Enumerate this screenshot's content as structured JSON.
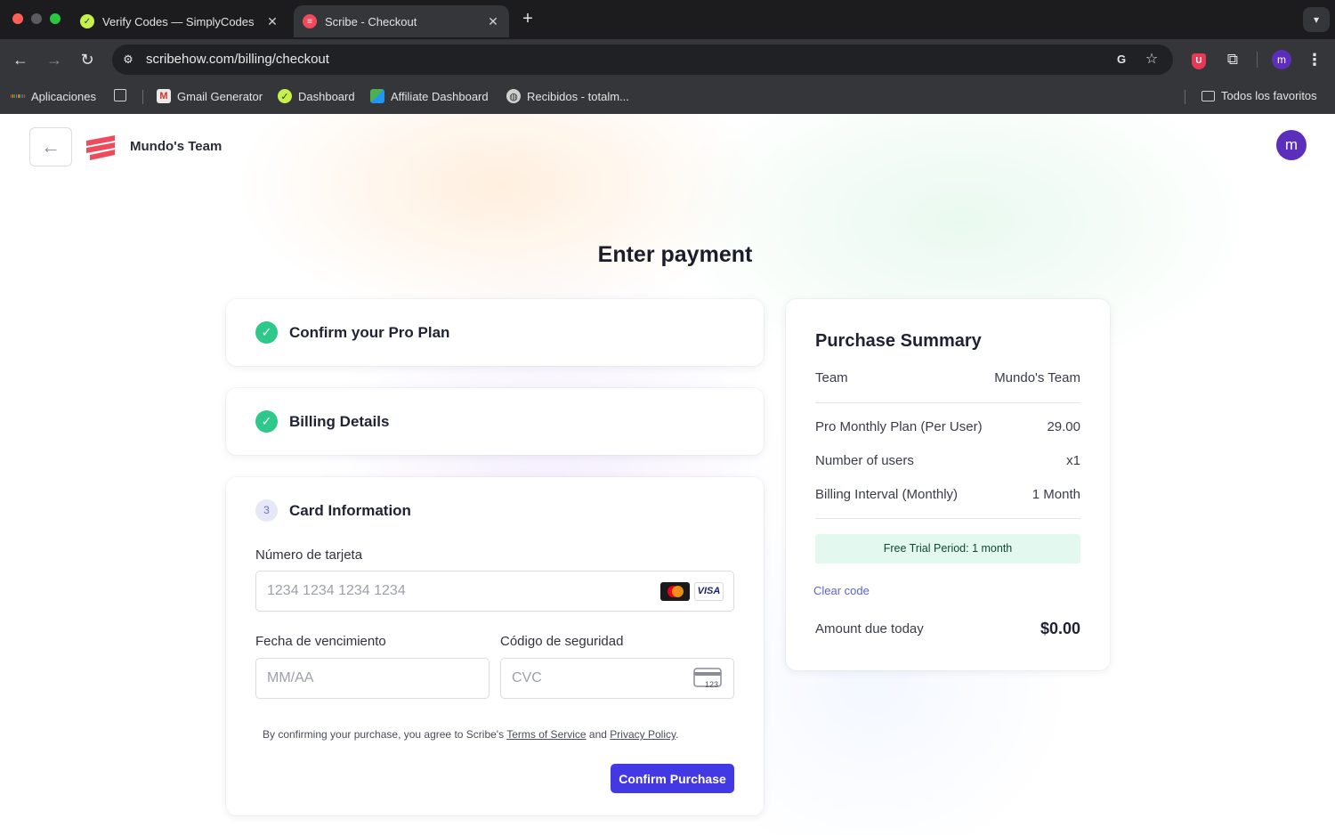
{
  "browser": {
    "tabs": [
      {
        "title": "Verify Codes — SimplyCodes",
        "favicon": "simplycodes-icon",
        "active": false
      },
      {
        "title": "Scribe - Checkout",
        "favicon": "scribe-icon",
        "active": true
      }
    ],
    "url": "scribehow.com/billing/checkout",
    "profile_initial": "m",
    "bookmarks": [
      {
        "label": "Aplicaciones",
        "icon": "apps-grid-icon"
      },
      {
        "label": "Gmail Generator",
        "icon": "gmail-generator-icon"
      },
      {
        "label": "Dashboard",
        "icon": "simplycodes-icon"
      },
      {
        "label": "Affiliate Dashboard",
        "icon": "affiliate-icon"
      },
      {
        "label": "Recibidos - totalm...",
        "icon": "globe-icon"
      }
    ],
    "all_bookmarks_label": "Todos los favoritos"
  },
  "header": {
    "team_name": "Mundo's Team",
    "avatar_initial": "m"
  },
  "page_title": "Enter payment",
  "steps": [
    {
      "title": "Confirm your Pro Plan",
      "status": "complete"
    },
    {
      "title": "Billing Details",
      "status": "complete"
    },
    {
      "title": "Card Information",
      "number": "3",
      "status": "current"
    }
  ],
  "card_form": {
    "card_number_label": "Número de tarjeta",
    "card_number_placeholder": "1234 1234 1234 1234",
    "card_brand_visa": "VISA",
    "cvc_icon_text": "123",
    "expiry_label": "Fecha de vencimiento",
    "expiry_placeholder": "MM/AA",
    "cvc_label": "Código de seguridad",
    "cvc_placeholder": "CVC",
    "legal_prefix": "By confirming your purchase, you agree to Scribe's",
    "terms_link": "Terms of Service",
    "legal_and": "and",
    "privacy_link": "Privacy Policy",
    "legal_suffix": ".",
    "confirm_label": "Confirm Purchase"
  },
  "summary": {
    "title": "Purchase Summary",
    "team_label": "Team",
    "team_value": "Mundo's Team",
    "rows": [
      {
        "label": "Pro Monthly Plan (Per User)",
        "value": "29.00"
      },
      {
        "label": "Number of users",
        "value": "x1"
      },
      {
        "label": "Billing Interval (Monthly)",
        "value": "1 Month"
      }
    ],
    "trial_text": "Free Trial Period: 1 month",
    "clear_code_label": "Clear code",
    "amount_due_label": "Amount due today",
    "amount_due_value": "$0.00"
  },
  "colors": {
    "accent": "#4339e4",
    "success": "#2ec98a",
    "avatar": "#5b2ebc",
    "scribe_brand": "#ef4b5c"
  }
}
